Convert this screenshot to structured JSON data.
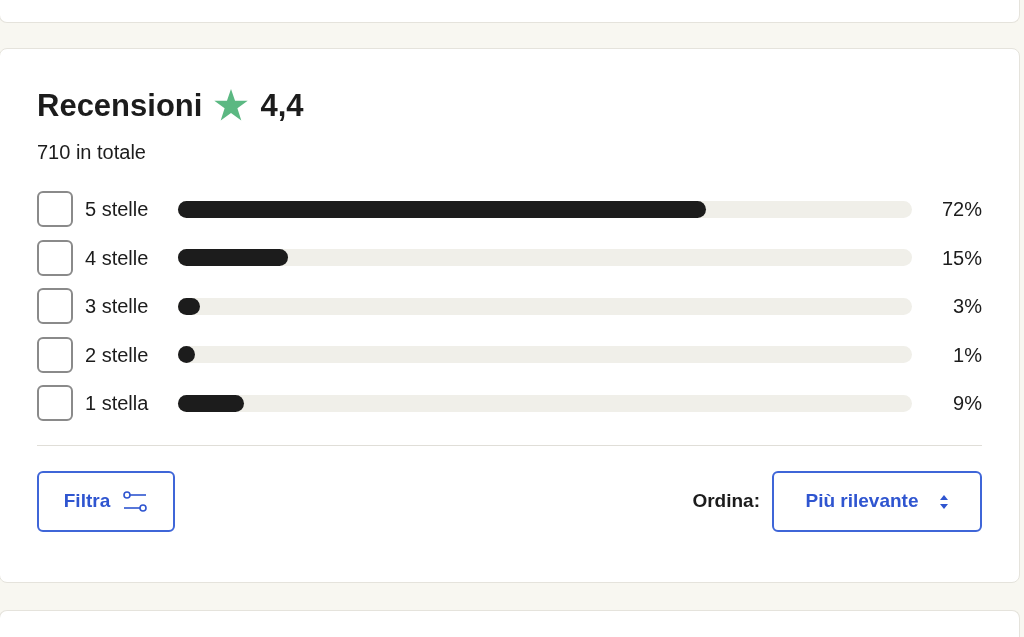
{
  "reviews": {
    "title": "Recensioni",
    "rating": "4,4",
    "total": "710 in totale",
    "rows": [
      {
        "label": "5 stelle",
        "checked": false,
        "level": 0.72,
        "percent": "72%"
      },
      {
        "label": "4 stelle",
        "checked": false,
        "level": 0.15,
        "percent": "15%"
      },
      {
        "label": "3 stelle",
        "checked": false,
        "level": 0.03,
        "percent": "3%"
      },
      {
        "label": "2 stelle",
        "checked": false,
        "level": 0.01,
        "percent": "1%"
      },
      {
        "label": "1 stella",
        "checked": false,
        "level": 0.09,
        "percent": "9%"
      }
    ],
    "filter_button": "Filtra",
    "sort_label": "Ordina:",
    "sort_select": "Più rilevante"
  }
}
